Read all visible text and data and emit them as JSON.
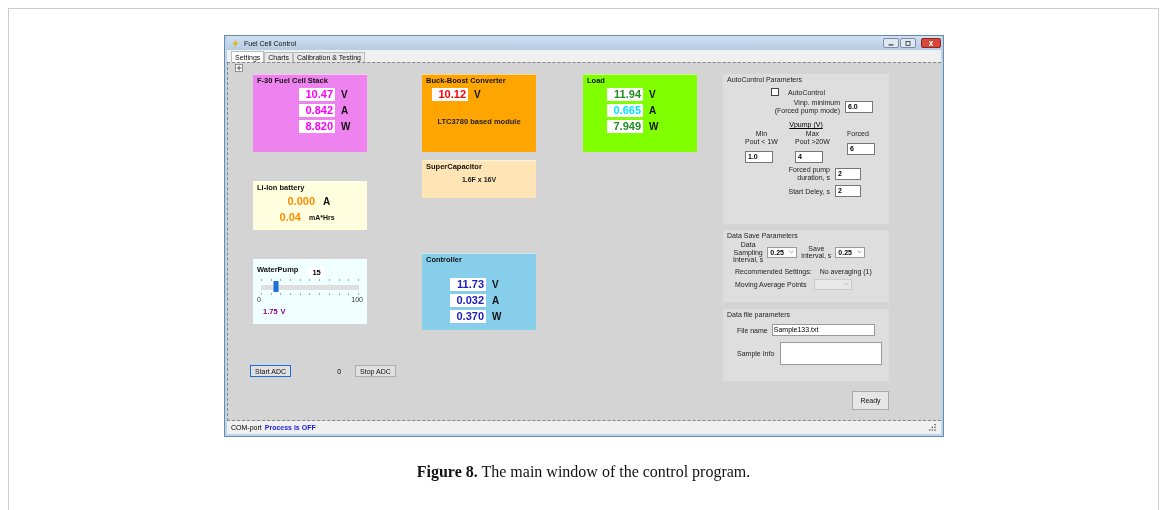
{
  "window": {
    "title": "Fuel Cell Control"
  },
  "tabs": [
    {
      "label": "Settings",
      "selected": true
    },
    {
      "label": "Charts",
      "selected": false
    },
    {
      "label": "Calibration & Testing",
      "selected": false
    }
  ],
  "fuel_cell_stack": {
    "title": "F-30 Fuel Cell Stack",
    "color": "#ee82ee",
    "readings": [
      {
        "value": "10.47",
        "unit": "V",
        "color": "#ff00ff"
      },
      {
        "value": "0.842",
        "unit": "A",
        "color": "#ff00ff"
      },
      {
        "value": "8.820",
        "unit": "W",
        "color": "#ff00ff"
      }
    ]
  },
  "li_ion_battery": {
    "title": "Li-Ion battery",
    "color": "#ffffe0",
    "readings": [
      {
        "value": "0.000",
        "unit": "A",
        "color": "#ff8c00"
      },
      {
        "value": "0.04",
        "unit": "mA*Hrs",
        "color": "#ff8c00"
      }
    ]
  },
  "water_pump": {
    "title": "WaterPump",
    "setting": "15",
    "level": 0.15,
    "min": "0",
    "max": "100",
    "reading": {
      "value": "1.75",
      "unit": "V",
      "color": "#8b008b"
    }
  },
  "buck_boost_converter": {
    "title": "Buck-Boost Converter",
    "color": "#ffa500",
    "readings": [
      {
        "value": "10.12",
        "unit": "V",
        "color": "#ff0000"
      }
    ],
    "note": "LTC3780 based module"
  },
  "supercapacitor": {
    "title": "SuperCapacitor",
    "color": "#ffe4b5",
    "note": "1.6F x 16V"
  },
  "controller": {
    "title": "Controller",
    "color": "#87ceeb",
    "readings": [
      {
        "value": "11.73",
        "unit": "V",
        "color": "#2020c0"
      },
      {
        "value": "0.032",
        "unit": "A",
        "color": "#2020c0"
      },
      {
        "value": "0.370",
        "unit": "W",
        "color": "#2020c0"
      }
    ]
  },
  "load": {
    "title": "Load",
    "color": "#7fff00",
    "readings": [
      {
        "value": "11.94",
        "unit": "V",
        "color": "#228b22"
      },
      {
        "value": "0.665",
        "unit": "A",
        "color": "#00e5ff"
      },
      {
        "value": "7.949",
        "unit": "W",
        "color": "#228b22"
      }
    ]
  },
  "adc": {
    "start_button": "Start ADC",
    "count": "0",
    "stop_button": "Stop ADC"
  },
  "auto_control": {
    "title": "AutoControl Parameters",
    "checkbox": {
      "label": "AutoControl",
      "checked": false
    },
    "vinp_label": "Vinp. minimum\n(Forced pump mode)",
    "vinp_value": "6.0",
    "vpump_heading": "Vpump (V)",
    "vpump": [
      {
        "label": "Min\nPout < 1W",
        "value": "1.0"
      },
      {
        "label": "Max\nPout >20W",
        "value": "4"
      },
      {
        "label": "Forced",
        "value": "6"
      }
    ],
    "duration_label": "Forced pump\nduration, s",
    "duration_value": "2",
    "delay_label": "Start Deley, s",
    "delay_value": "2"
  },
  "data_save": {
    "title": "Data Save Parameters",
    "sampling_label": "Data\nSampling\nInterval, s",
    "sampling_value": "0.25",
    "save_label": "Save\ninterval, s",
    "save_value": "0.25",
    "recommended_label": "Recommended Settings:",
    "recommended_value": "No averaging (1)",
    "moving_label": "Moving Average Points"
  },
  "data_file": {
    "title": "Data file parameters",
    "file_label": "File name",
    "file_value": "Sample133.txt",
    "info_label": "Sample  Info"
  },
  "ready_button": "Ready",
  "status_bar": {
    "label": "COM-port",
    "status": "Process is OFF"
  },
  "caption": "**Figure 8.** The main window of the control program."
}
